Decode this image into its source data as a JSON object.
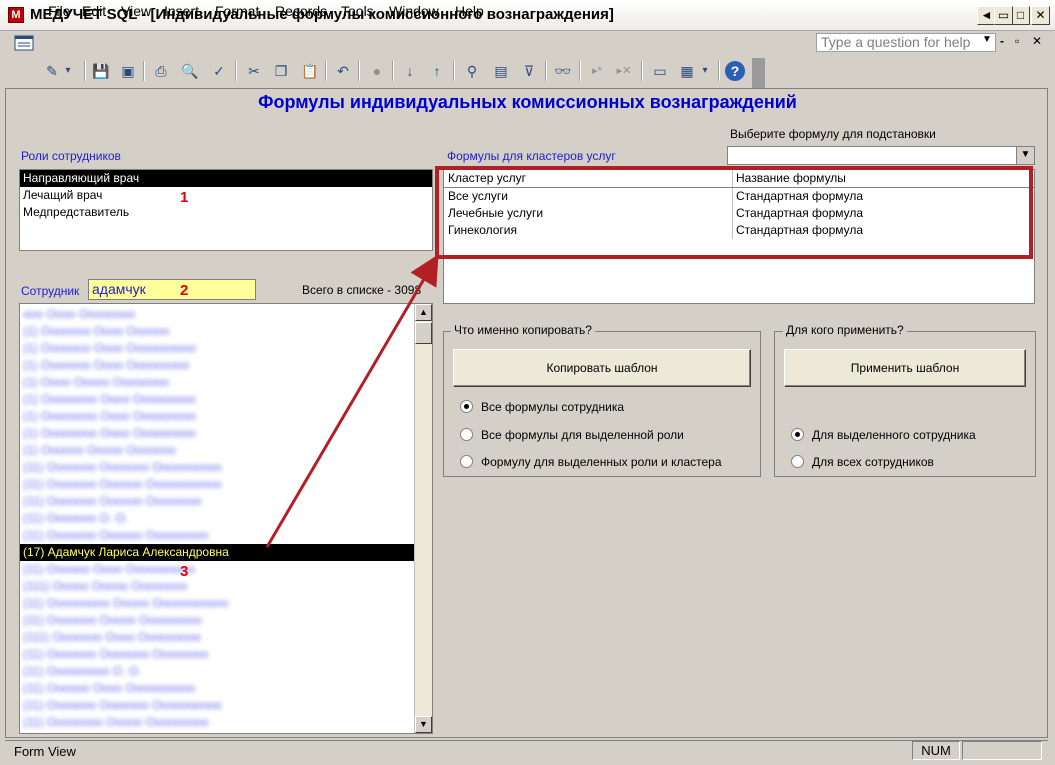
{
  "window": {
    "icon_letter": "M",
    "title": "МЕДУЧЕТ SQL - [Индивидуальные формулы комиссионного вознаграждения]",
    "buttons": {
      "minimize": "◄",
      "maximize": "□",
      "close": "✕"
    }
  },
  "menu": {
    "items": [
      "File",
      "Edit",
      "View",
      "Insert",
      "Format",
      "Records",
      "Tools",
      "Window",
      "Help"
    ],
    "ask_placeholder": "Type a question for help",
    "mdi": {
      "minimize": "-",
      "restore": "▫",
      "close": "✕"
    }
  },
  "toolbar": {
    "icons": [
      "design-view-icon",
      "save-icon",
      "save-as-icon",
      "print-icon",
      "print-preview-icon",
      "spelling-icon",
      "cut-icon",
      "copy-icon",
      "paste-icon",
      "undo-icon",
      "hyperlink-icon",
      "sort-asc-icon",
      "sort-desc-icon",
      "filter-by-selection-icon",
      "filter-by-form-icon",
      "apply-filter-icon",
      "find-icon",
      "new-record-icon",
      "delete-record-icon",
      "database-window-icon",
      "new-object-icon",
      "help-icon"
    ],
    "glyphs": [
      "✎",
      "▾",
      "💾",
      "▣",
      "⎙",
      "🔍",
      "✓",
      "✂",
      "❐",
      "📋",
      "↶",
      "●",
      "↓",
      "↑",
      "⚲",
      "▤",
      "⊽",
      "👓",
      "▸*",
      "▸✕",
      "▭",
      "▦",
      "▾",
      "?"
    ]
  },
  "form": {
    "title": "Формулы индивидуальных комиссионных вознаграждений",
    "roles": {
      "label": "Роли сотрудников",
      "items": [
        "Направляющий врач",
        "Лечащий врач",
        "Медпредставитель"
      ],
      "selected_index": 0
    },
    "formula_select_label": "Выберите формулу для подстановки",
    "formula_select_arrow": "▼",
    "formulas": {
      "label": "Формулы для кластеров услуг",
      "headers": [
        "Кластер услуг",
        "Название формулы"
      ],
      "rows": [
        [
          "Все услуги",
          "Стандартная формула"
        ],
        [
          "Лечебные услуги",
          "Стандартная формула"
        ],
        [
          "Гинекология",
          "Стандартная формула"
        ]
      ]
    },
    "employee": {
      "label": "Сотрудник",
      "value": "адамчук",
      "count_label": "Всего в списке - 3098",
      "selected": "(17) Адамчук Лариса Александровна",
      "scroll_up": "▲",
      "scroll_down": "▼"
    },
    "annotations": {
      "n1": "1",
      "n2": "2",
      "n3": "3"
    },
    "copy_group": {
      "label": "Что именно копировать?",
      "button": "Копировать шаблон",
      "options": [
        "Все формулы сотрудника",
        "Все формулы для выделенной роли",
        "Формулу для выделенных роли и кластера"
      ],
      "selected_index": 0
    },
    "apply_group": {
      "label": "Для кого применить?",
      "button": "Применить шаблон",
      "options": [
        "Для выделенного сотрудника",
        "Для всех сотрудников"
      ],
      "selected_index": 0
    }
  },
  "status": {
    "text": "Form View",
    "num": "NUM"
  },
  "colors": {
    "accent_red": "#b21f24",
    "title_blue": "#0000d0",
    "label_blue": "#1d1dcf",
    "input_yellow": "#ffff99"
  }
}
